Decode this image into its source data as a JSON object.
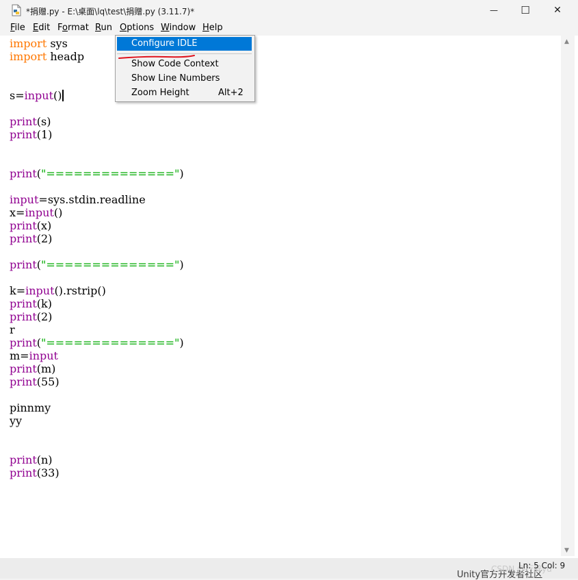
{
  "window": {
    "title": "*捐赠.py - E:\\桌面\\lq\\test\\捐赠.py (3.11.7)*",
    "minimize_glyph": "—",
    "maximize_glyph": "☐",
    "close_glyph": "✕"
  },
  "menubar": {
    "items": [
      {
        "label": "File",
        "underline": "F"
      },
      {
        "label": "Edit",
        "underline": "E"
      },
      {
        "label": "Format",
        "underline": "o"
      },
      {
        "label": "Run",
        "underline": "R"
      },
      {
        "label": "Options",
        "underline": "O"
      },
      {
        "label": "Window",
        "underline": "W"
      },
      {
        "label": "Help",
        "underline": "H"
      }
    ]
  },
  "options_menu": {
    "items": [
      {
        "label": "Configure IDLE",
        "accel": ""
      },
      {
        "label": "Show Code Context",
        "accel": ""
      },
      {
        "label": "Show Line Numbers",
        "accel": ""
      },
      {
        "label": "Zoom Height",
        "accel": "Alt+2"
      }
    ],
    "highlight_color": "#0078d7"
  },
  "editor": {
    "lines": [
      [
        [
          "kw",
          "import"
        ],
        [
          "t",
          " sys"
        ]
      ],
      [
        [
          "kw",
          "import"
        ],
        [
          "t",
          " headp"
        ]
      ],
      [],
      [],
      [
        [
          "t",
          "s="
        ],
        [
          "bi",
          "input"
        ],
        [
          "t",
          "()"
        ],
        [
          "cursor",
          ""
        ]
      ],
      [],
      [
        [
          "bi",
          "print"
        ],
        [
          "t",
          "(s)"
        ]
      ],
      [
        [
          "bi",
          "print"
        ],
        [
          "t",
          "(1)"
        ]
      ],
      [],
      [],
      [
        [
          "bi",
          "print"
        ],
        [
          "t",
          "("
        ],
        [
          "st",
          "\"==============\""
        ],
        [
          "t",
          ")"
        ]
      ],
      [],
      [
        [
          "bi",
          "input"
        ],
        [
          "t",
          "=sys.stdin.readline"
        ]
      ],
      [
        [
          "t",
          "x="
        ],
        [
          "bi",
          "input"
        ],
        [
          "t",
          "()"
        ]
      ],
      [
        [
          "bi",
          "print"
        ],
        [
          "t",
          "(x)"
        ]
      ],
      [
        [
          "bi",
          "print"
        ],
        [
          "t",
          "(2)"
        ]
      ],
      [],
      [
        [
          "bi",
          "print"
        ],
        [
          "t",
          "("
        ],
        [
          "st",
          "\"==============\""
        ],
        [
          "t",
          ")"
        ]
      ],
      [],
      [
        [
          "t",
          "k="
        ],
        [
          "bi",
          "input"
        ],
        [
          "t",
          "().rstrip()"
        ]
      ],
      [
        [
          "bi",
          "print"
        ],
        [
          "t",
          "(k)"
        ]
      ],
      [
        [
          "bi",
          "print"
        ],
        [
          "t",
          "(2)"
        ]
      ],
      [
        [
          "t",
          "r"
        ]
      ],
      [
        [
          "bi",
          "print"
        ],
        [
          "t",
          "("
        ],
        [
          "st",
          "\"==============\""
        ],
        [
          "t",
          ")"
        ]
      ],
      [
        [
          "t",
          "m="
        ],
        [
          "bi",
          "input"
        ]
      ],
      [
        [
          "bi",
          "print"
        ],
        [
          "t",
          "(m)"
        ]
      ],
      [
        [
          "bi",
          "print"
        ],
        [
          "t",
          "(55)"
        ]
      ],
      [],
      [
        [
          "t",
          "pinnmy"
        ]
      ],
      [
        [
          "t",
          "yy"
        ]
      ],
      [],
      [],
      [
        [
          "bi",
          "print"
        ],
        [
          "t",
          "(n)"
        ]
      ],
      [
        [
          "bi",
          "print"
        ],
        [
          "t",
          "(33)"
        ]
      ]
    ],
    "colors": {
      "keyword": "#ff7700",
      "builtin": "#900090",
      "string": "#00aa00"
    }
  },
  "statusbar": {
    "position": "Ln: 5  Col: 9"
  },
  "background": {
    "watermark": "CSDN @行辞yu",
    "bottom_text": "Unity官方开发者社区"
  }
}
